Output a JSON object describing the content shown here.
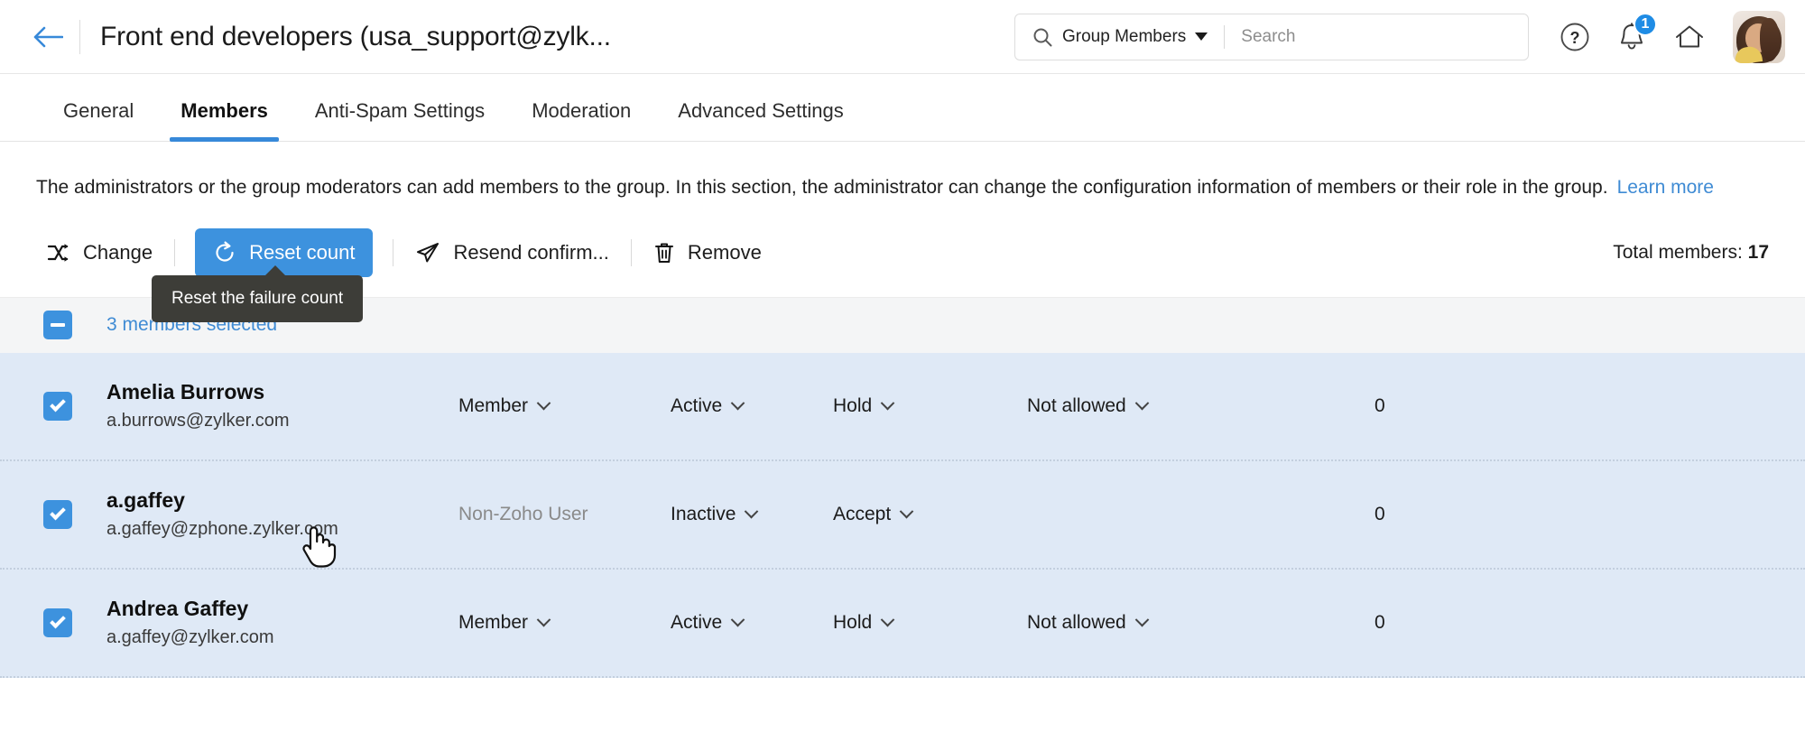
{
  "header": {
    "back_icon": "arrow-left-icon",
    "title": "Front end developers (usa_support@zylk...",
    "search": {
      "scope_label": "Group Members",
      "placeholder": "Search",
      "value": "",
      "search_icon": "search-icon",
      "caret_icon": "chevron-down-icon"
    },
    "help_icon": "question-circle-icon",
    "notifications_icon": "bell-icon",
    "notification_count": "1",
    "home_icon": "home-icon",
    "avatar": "user-avatar"
  },
  "tabs": [
    {
      "label": "General",
      "active": false
    },
    {
      "label": "Members",
      "active": true
    },
    {
      "label": "Anti-Spam Settings",
      "active": false
    },
    {
      "label": "Moderation",
      "active": false
    },
    {
      "label": "Advanced Settings",
      "active": false
    }
  ],
  "description": {
    "text": "The administrators or the group moderators can add members to the group. In this section, the administrator can change the configuration information of members or their role in the group.",
    "link_label": "Learn more"
  },
  "toolbar": {
    "change_label": "Change",
    "change_icon": "shuffle-icon",
    "reset_label": "Reset count",
    "reset_icon": "refresh-circle-icon",
    "resend_label": "Resend confirm...",
    "resend_icon": "send-plane-icon",
    "remove_label": "Remove",
    "remove_icon": "trash-icon",
    "total_label": "Total members:",
    "total_value": "17",
    "accent_color": "#3d92de"
  },
  "tooltip": {
    "text": "Reset the failure count",
    "background": "#3d3d38"
  },
  "selection_bar": {
    "checkbox_state": "indeterminate",
    "label": "3 members selected"
  },
  "table": {
    "rows": [
      {
        "checked": true,
        "name": "Amelia Burrows",
        "email": "a.burrows@zylker.com",
        "role": "Member",
        "role_is_dropdown": true,
        "status": "Active",
        "moderation": "Hold",
        "permission": "Not allowed",
        "count": "0"
      },
      {
        "checked": true,
        "name": "a.gaffey",
        "email": "a.gaffey@zphone.zylker.com",
        "role": "Non-Zoho User",
        "role_is_dropdown": false,
        "status": "Inactive",
        "moderation": "Accept",
        "permission": "",
        "count": "0"
      },
      {
        "checked": true,
        "name": "Andrea Gaffey",
        "email": "a.gaffey@zylker.com",
        "role": "Member",
        "role_is_dropdown": true,
        "status": "Active",
        "moderation": "Hold",
        "permission": "Not allowed",
        "count": "0"
      }
    ]
  }
}
